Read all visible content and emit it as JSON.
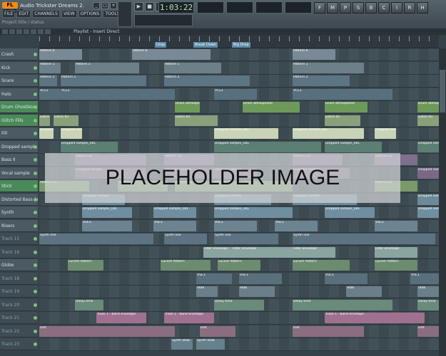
{
  "app": {
    "logo": "FL STUDIO",
    "title": "Audio Trickster Dreams 2.flp",
    "hint": "Project title / status"
  },
  "menu": {
    "items": [
      "FILE",
      "EDIT",
      "CHANNELS",
      "VIEW",
      "OPTIONS",
      "TOOLS",
      "?"
    ]
  },
  "window_buttons": [
    "_",
    "□",
    "×"
  ],
  "transport": {
    "buttons": [
      "▶",
      "■",
      "●"
    ],
    "time": "1:03:22"
  },
  "toolbar": {
    "buttons": [
      "F",
      "M",
      "P",
      "S",
      "B",
      "C",
      "I",
      "R",
      "H"
    ]
  },
  "playlist": {
    "title": "Playlist - Insert Direct"
  },
  "ruler": {
    "markers": [
      "Drop",
      "Break Down",
      "Big Drop"
    ]
  },
  "tracks": [
    {
      "name": "Crash",
      "color": "default",
      "clips": [
        {
          "label": "Pattern 6",
          "c": "#7a8a94"
        }
      ]
    },
    {
      "name": "Kick",
      "color": "default",
      "clips": [
        {
          "label": "Pattern 1",
          "c": "#6d7f88"
        }
      ]
    },
    {
      "name": "Snare",
      "color": "default",
      "clips": [
        {
          "label": "Pattern 2",
          "c": "#5d7482"
        }
      ]
    },
    {
      "name": "Hats",
      "color": "default",
      "clips": [
        {
          "label": "VCL2",
          "c": "#58707e"
        }
      ]
    },
    {
      "name": "Drum Ghostbox",
      "color": "green",
      "clips": [
        {
          "label": "Drum atmosphere",
          "c": "#6d9a5a"
        }
      ]
    },
    {
      "name": "Glitch Fills",
      "color": "green",
      "clips": [
        {
          "label": "Glitch fill",
          "c": "#8aa07a"
        }
      ]
    },
    {
      "name": "Fill",
      "color": "default",
      "clips": [
        {
          "label": "Dropped sample_181",
          "c": "#c9d3b7"
        }
      ]
    },
    {
      "name": "Dropped sample",
      "color": "default",
      "clips": [
        {
          "label": "Dropped sample_181",
          "c": "#5c7f73"
        }
      ]
    },
    {
      "name": "Bass II",
      "color": "default",
      "clips": [
        {
          "label": "Pattern 12",
          "c": "#7f6e8c"
        }
      ]
    },
    {
      "name": "Vocal sample",
      "color": "default",
      "clips": [
        {
          "label": "Dropped sample",
          "c": "#7a6886"
        }
      ]
    },
    {
      "name": "Stick",
      "color": "green",
      "clips": [
        {
          "label": "Pattern 23",
          "c": "#7a9a6a"
        }
      ]
    },
    {
      "name": "Distorted Bass Arp",
      "color": "default",
      "clips": [
        {
          "label": "Dropped sample",
          "c": "#6d8a9a"
        }
      ]
    },
    {
      "name": "Synth",
      "color": "default",
      "clips": [
        {
          "label": "Dropped sample_181",
          "c": "#6f8fa0"
        }
      ]
    },
    {
      "name": "Risers",
      "color": "default",
      "clips": [
        {
          "label": "VSC1",
          "c": "#6c8491"
        }
      ]
    },
    {
      "name": "Track 15",
      "color": "dim",
      "clips": [
        {
          "label": "Synth line",
          "c": "#5d7382"
        }
      ]
    },
    {
      "name": "Track 16",
      "color": "dim",
      "clips": [
        {
          "label": "Filter envelope",
          "c": "#8aa4a0"
        }
      ]
    },
    {
      "name": "Globe",
      "color": "default",
      "clips": [
        {
          "label": "Lucent Pattern",
          "c": "#6b8c6f"
        }
      ]
    },
    {
      "name": "Track 18",
      "color": "dim",
      "clips": [
        {
          "label": "VSC1",
          "c": "#5a6f7c"
        }
      ]
    },
    {
      "name": "Track 19",
      "color": "dim",
      "clips": [
        {
          "label": "Stab",
          "c": "#6a7f8a"
        }
      ]
    },
    {
      "name": "Track 20",
      "color": "dim",
      "clips": [
        {
          "label": "Delay time",
          "c": "#6a8a7a"
        }
      ]
    },
    {
      "name": "Track 21",
      "color": "dim",
      "clips": [
        {
          "label": "Track 1 - band envelope",
          "c": "#a07090"
        }
      ]
    },
    {
      "name": "Track 22",
      "color": "dim",
      "clips": [
        {
          "label": "Dist",
          "c": "#8a6e80"
        }
      ]
    },
    {
      "name": "Track 23",
      "color": "dim",
      "clips": [
        {
          "label": "Synth Stab",
          "c": "#66808c"
        }
      ]
    }
  ],
  "placeholder": {
    "text": "PLACEHOLDER IMAGE"
  }
}
